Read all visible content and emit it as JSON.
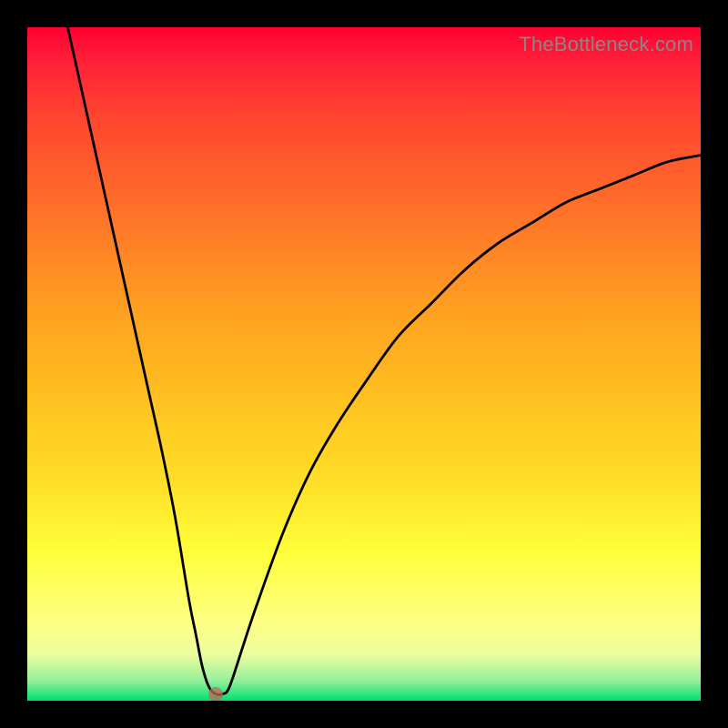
{
  "watermark": "TheBottleneck.com",
  "chart_data": {
    "type": "line",
    "title": "",
    "xlabel": "",
    "ylabel": "",
    "xlim": [
      0,
      100
    ],
    "ylim": [
      0,
      100
    ],
    "background_gradient": {
      "top_color": "#ff0032",
      "bottom_color": "#00e070",
      "direction": "vertical"
    },
    "series": [
      {
        "name": "bottleneck-curve",
        "x": [
          6,
          8,
          10,
          12,
          14,
          16,
          18,
          20,
          22,
          24,
          25,
          26,
          27,
          28,
          29,
          30,
          32,
          34,
          38,
          42,
          46,
          50,
          55,
          60,
          65,
          70,
          75,
          80,
          85,
          90,
          95,
          100
        ],
        "y": [
          100,
          91,
          82,
          73,
          64,
          55,
          46,
          37,
          27,
          15,
          10,
          5,
          2,
          1,
          1,
          2,
          8,
          14,
          25,
          34,
          41,
          47,
          54,
          59,
          64,
          68,
          71,
          74,
          76,
          78,
          80,
          81
        ]
      }
    ],
    "marker": {
      "name": "optimal-point",
      "x": 28,
      "y": 1,
      "color": "#c06a5a"
    }
  }
}
